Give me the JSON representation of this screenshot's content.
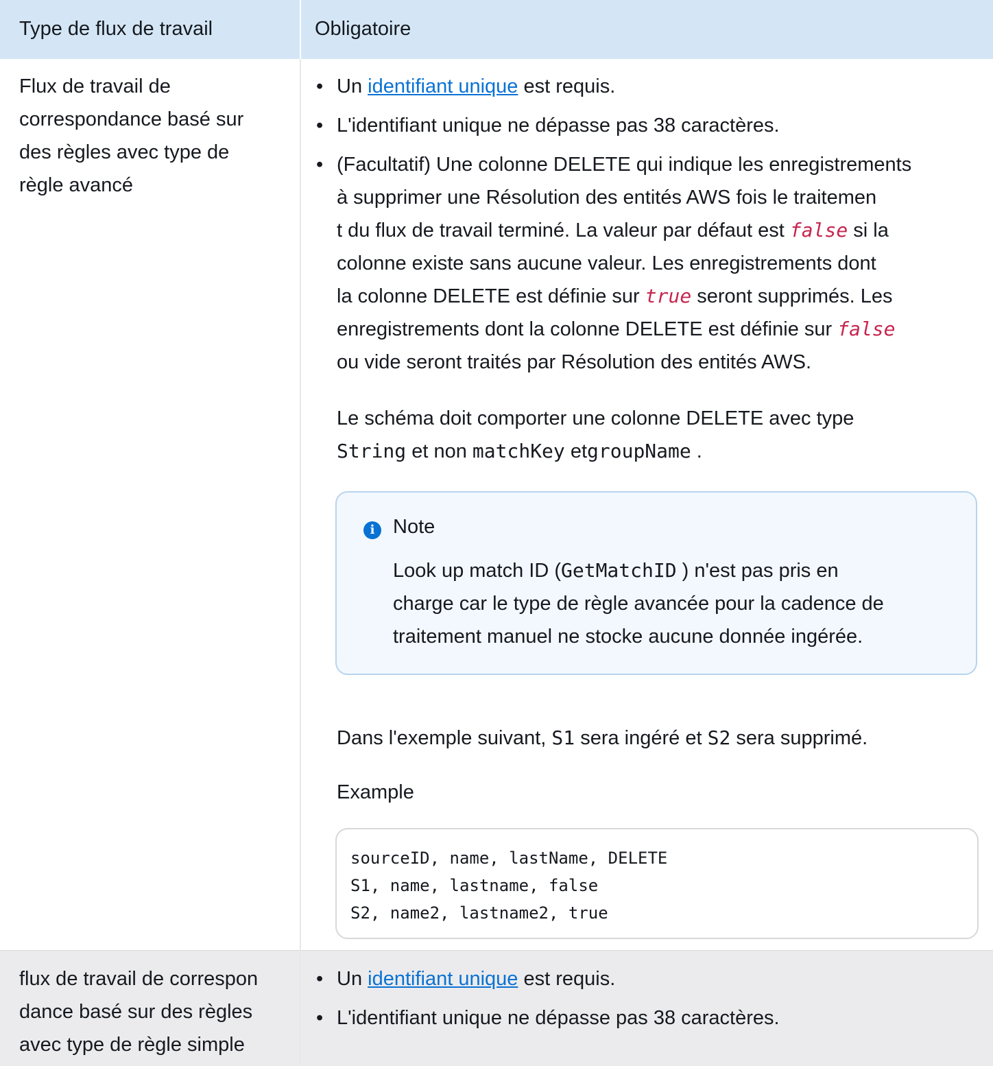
{
  "header": {
    "col1": "Type de flux de travail",
    "col2": "Obligatoire"
  },
  "row1": {
    "type_lines": [
      "Flux de travail de",
      "correspondance basé sur",
      "des règles avec type de",
      "règle avancé"
    ],
    "bullet1": {
      "prefix": "Un ",
      "link": "identifiant unique",
      "suffix": " est requis."
    },
    "bullet2": "L'identifiant unique ne dépasse pas 38 caractères.",
    "bullet3": {
      "line1": "(Facultatif) Une colonne DELETE qui indique les enregistrements",
      "line2": "à supprimer une Résolution des entités AWS fois le traitemen",
      "line3a": "t du flux de travail terminé. La valeur par défaut est ",
      "line3code": "false",
      "line3b": " si la",
      "line4": "colonne existe sans aucune valeur. Les enregistrements dont",
      "line5a": "la colonne DELETE est définie sur ",
      "line5code": "true",
      "line5b": " seront supprimés. Les",
      "line6a": "enregistrements dont la colonne DELETE est définie sur ",
      "line6code": "false",
      "line7": "ou vide seront traités par Résolution des entités AWS."
    },
    "schema": {
      "line1": "Le schéma doit comporter une colonne DELETE avec type",
      "code1": "String",
      "mid": " et non ",
      "code2": "matchKey",
      "mid2": " et",
      "code3": "groupName",
      "end": " ."
    },
    "note": {
      "title": "Note",
      "icon": "i",
      "body_a": "Look up match ID (",
      "body_code": "GetMatchID",
      "body_b": " ) n'est pas pris en",
      "body_line2": "charge car le type de règle avancée pour la cadence de",
      "body_line3": "traitement manuel ne stocke aucune donnée ingérée."
    },
    "example_intro": {
      "a": "Dans l'exemple suivant, ",
      "s1": "S1",
      "b": " sera ingéré et ",
      "s2": "S2",
      "c": " sera supprimé."
    },
    "example_label": "Example",
    "code_lines": [
      "sourceID, name, lastName, DELETE",
      "S1, name, lastname, false",
      "S2, name2, lastname2, true"
    ]
  },
  "row2": {
    "type_lines": [
      "flux de travail de correspon",
      "dance basé sur des règles",
      "avec type de règle simple"
    ],
    "bullet1": {
      "prefix": "Un ",
      "link": "identifiant unique",
      "suffix": " est requis."
    },
    "bullet2": "L'identifiant unique ne dépasse pas 38 caractères."
  }
}
